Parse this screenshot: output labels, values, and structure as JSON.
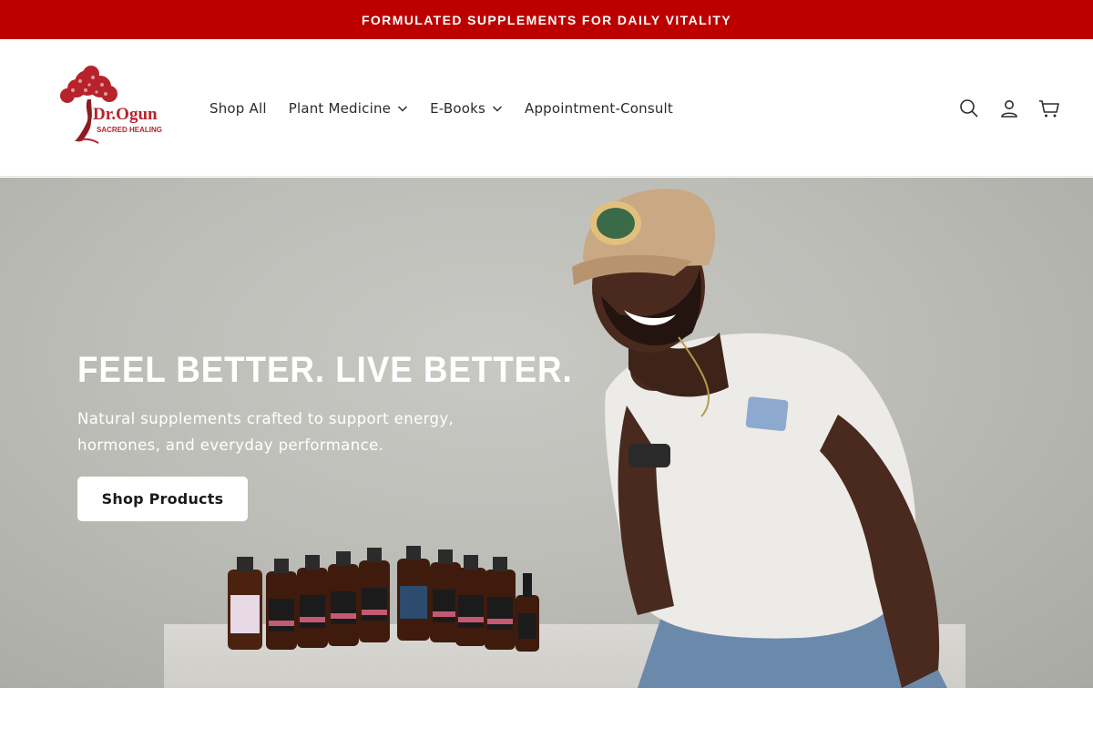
{
  "announcement": {
    "text": "FORMULATED SUPPLEMENTS FOR DAILY VITALITY"
  },
  "header": {
    "logo": {
      "name": "Dr.Ogun",
      "tagline": "SACRED HEALING"
    },
    "nav": [
      {
        "label": "Shop All",
        "has_dropdown": false
      },
      {
        "label": "Plant Medicine",
        "has_dropdown": true
      },
      {
        "label": "E-Books",
        "has_dropdown": true
      },
      {
        "label": "Appointment-Consult",
        "has_dropdown": false
      }
    ],
    "icons": [
      "search-icon",
      "account-icon",
      "cart-icon"
    ]
  },
  "hero": {
    "title": "FEEL BETTER. LIVE BETTER.",
    "subtitle": "Natural supplements crafted to support energy, hormones, and everyday performance.",
    "button_label": "Shop Products"
  },
  "colors": {
    "brand_red": "#bc0000",
    "background": "#ffffff",
    "text": "#1a1a1a"
  }
}
